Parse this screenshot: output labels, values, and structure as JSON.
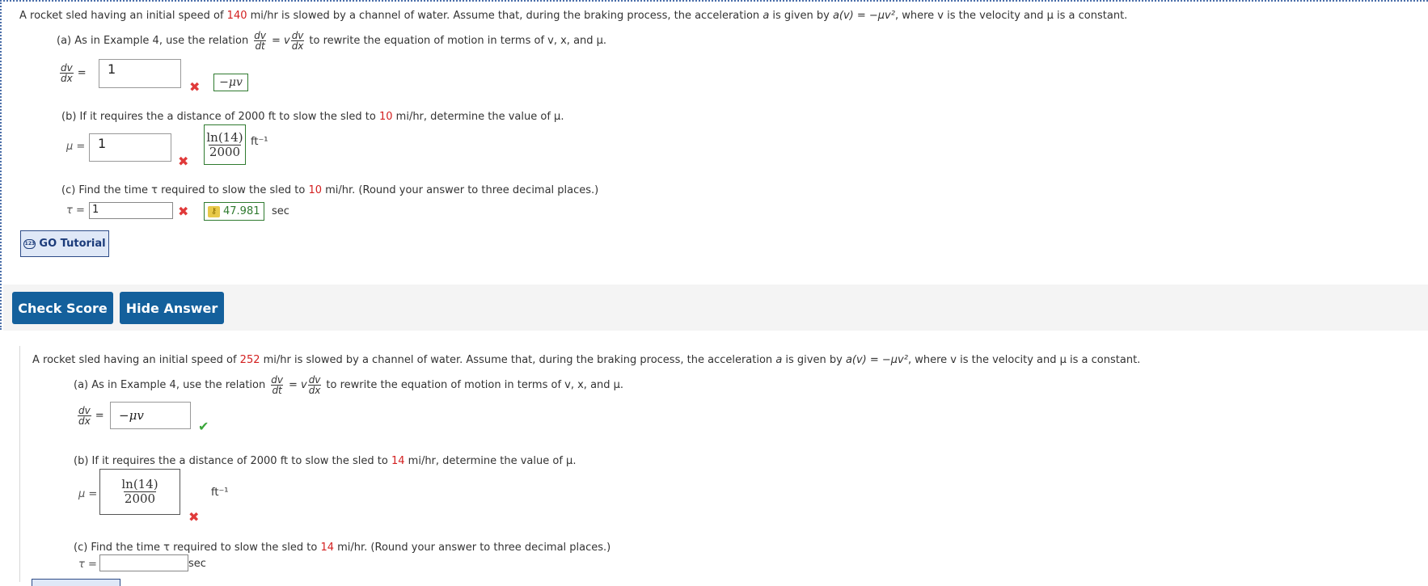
{
  "q1": {
    "intro_pre": "A rocket sled having an initial speed of ",
    "speed": "140",
    "intro_post": " mi/hr is slowed by a channel of water. Assume that, during the braking process, the acceleration ",
    "a_var": "a",
    "intro_post2": " is given by ",
    "formula": "a(v) = −μv²",
    "intro_end": ",  where v is the velocity and μ is a constant.",
    "a_label_pre": "(a) As in Example 4, use the relation",
    "rel_eq": "= v",
    "a_label_post": "to rewrite the equation of motion in terms of v, x, and μ.",
    "dv": "dv",
    "dt": "dt",
    "dx": "dx",
    "a_value": "1",
    "a_answer": "−μv",
    "b_label_pre": "(b) If it requires the a distance of 2000 ft to slow the sled to ",
    "b_speed": "10",
    "b_label_post": " mi/hr, determine the value of μ.",
    "mu_label": "μ =",
    "b_value": "1",
    "b_answer_num": "ln(14)",
    "b_answer_den": "2000",
    "b_unit": "ft⁻¹",
    "c_label_pre": "(c) Find the time τ required to slow the sled to ",
    "c_speed": "10",
    "c_label_post": " mi/hr. (Round your answer to three decimal places.)",
    "tau_label": "τ =",
    "c_value": "1",
    "c_answer": "47.981",
    "c_unit": "sec",
    "tutorial": "GO Tutorial",
    "check_score": "Check Score",
    "hide_answer": "Hide Answer"
  },
  "q2": {
    "intro_pre": "A rocket sled having an initial speed of ",
    "speed": "252",
    "intro_post": " mi/hr is slowed by a channel of water. Assume that, during the braking process, the acceleration ",
    "a_var": "a",
    "intro_post2": " is given by ",
    "formula": "a(v) = −μv²",
    "intro_end": ",  where v is the velocity and μ is a constant.",
    "a_label_pre": "(a) As in Example 4, use the relation",
    "rel_eq": "= v",
    "a_label_post": "to rewrite the equation of motion in terms of v, x, and μ.",
    "dv": "dv",
    "dt": "dt",
    "dx": "dx",
    "a_value": "−μv",
    "b_label_pre": "(b) If it requires the a distance of 2000 ft to slow the sled to ",
    "b_speed": "14",
    "b_label_post": " mi/hr, determine the value of μ.",
    "mu_label": "μ =",
    "b_value_num": "ln(14)",
    "b_value_den": "2000",
    "b_unit": "ft⁻¹",
    "c_label_pre": "(c) Find the time τ required to slow the sled to ",
    "c_speed": "14",
    "c_label_post": " mi/hr. (Round your answer to three decimal places.)",
    "tau_label": "τ =",
    "c_value": "",
    "c_unit": "sec"
  },
  "colors": {
    "accent": "#14609c",
    "wrong": "#e03a3a",
    "correct": "#3aa63a",
    "highlight": "#d32020"
  }
}
